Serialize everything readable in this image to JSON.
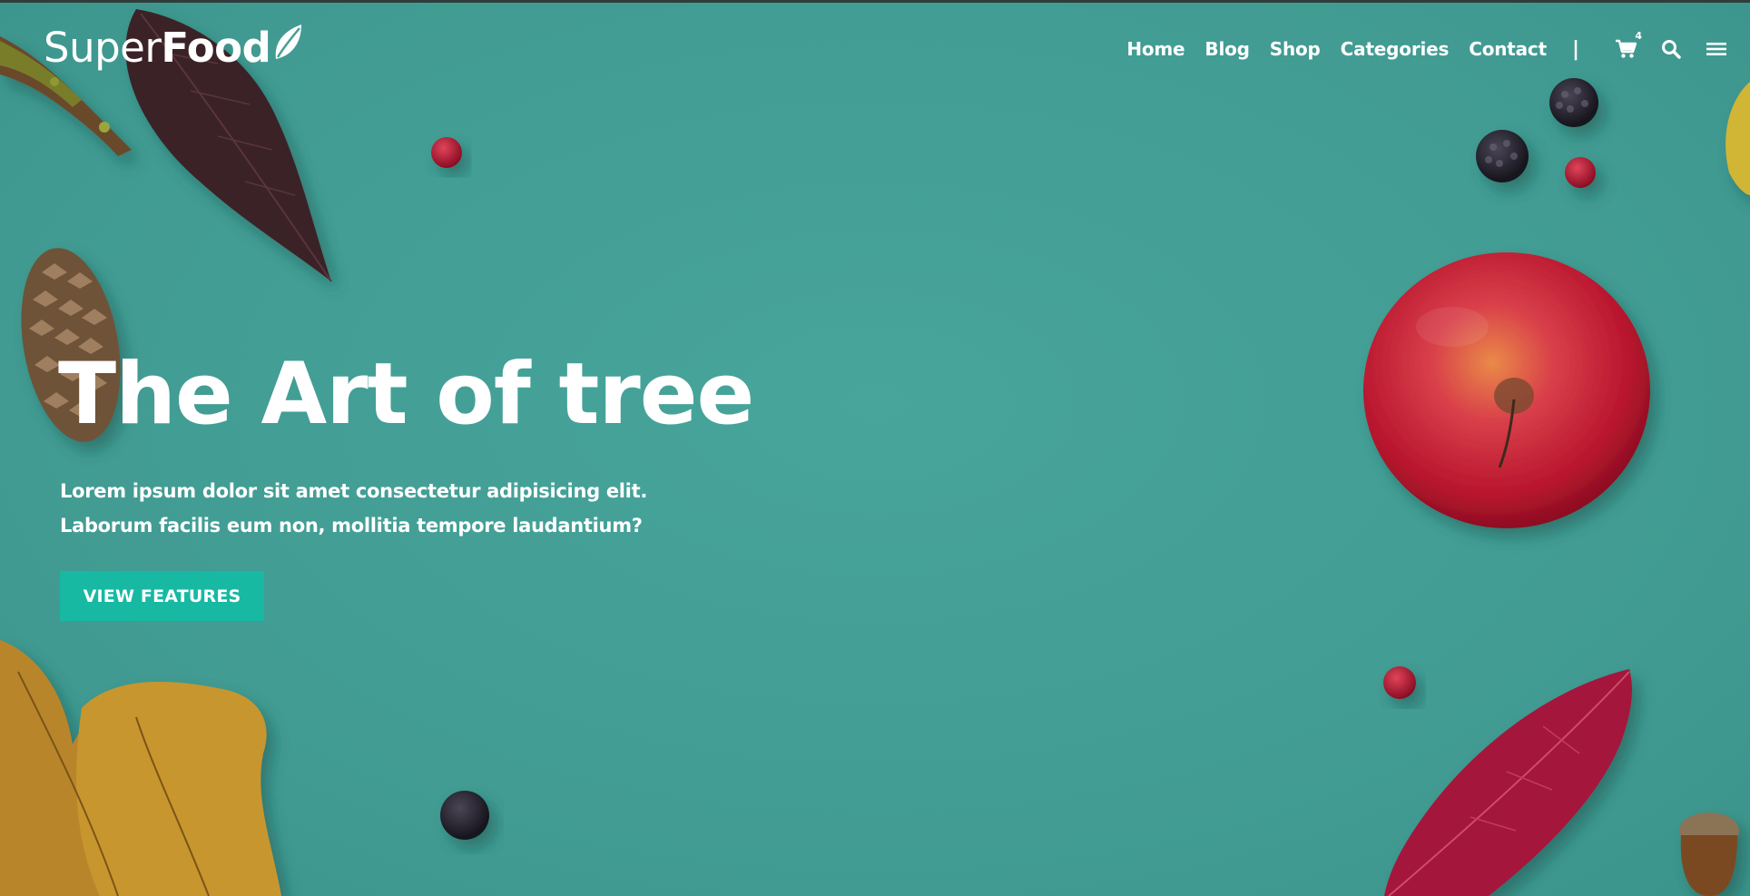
{
  "brand": {
    "logo_part1": "Super",
    "logo_part2": "Food"
  },
  "nav": {
    "items": [
      {
        "label": "Home"
      },
      {
        "label": "Blog"
      },
      {
        "label": "Shop"
      },
      {
        "label": "Categories"
      },
      {
        "label": "Contact"
      }
    ],
    "separator": "|",
    "cart_count": "4"
  },
  "hero": {
    "title": "The Art of tree",
    "description": "Lorem ipsum dolor sit amet consectetur adipisicing elit. Laborum facilis eum non, mollitia tempore laudantium?",
    "cta_label": "VIEW FEATURES"
  },
  "colors": {
    "background": "#439f96",
    "cta": "#17b9a3",
    "text": "#ffffff"
  },
  "icons": [
    "leaf-logo-icon",
    "cart-icon",
    "search-icon",
    "menu-icon"
  ]
}
